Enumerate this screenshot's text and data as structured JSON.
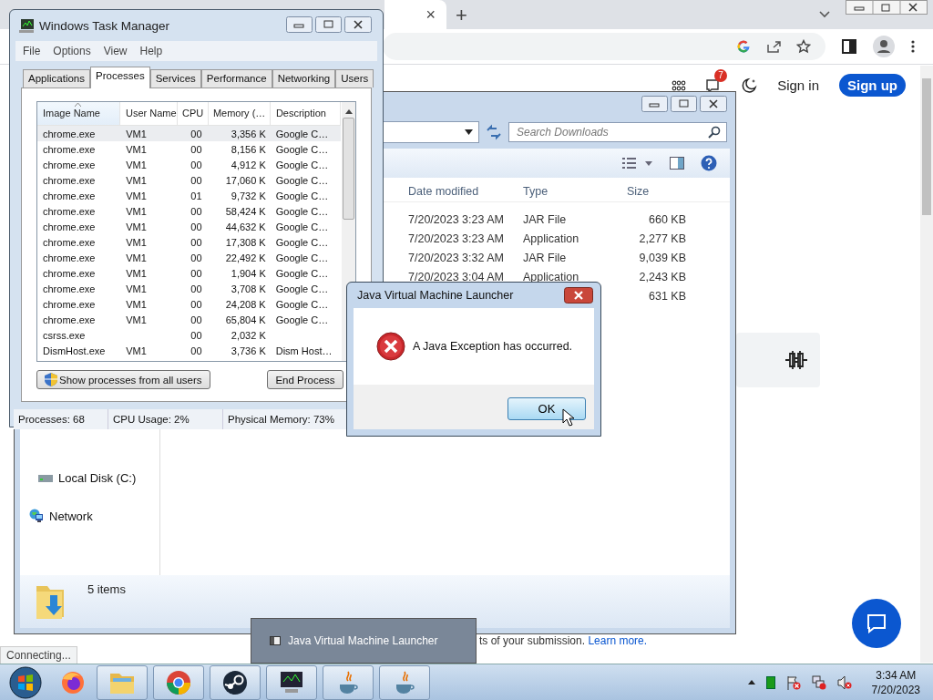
{
  "browser": {
    "tab_close": "×",
    "new_tab": "+",
    "sign_in": "Sign in",
    "sign_up": "Sign up",
    "notification_count": "7",
    "footer_text": "ts of your submission.",
    "footer_link": "Learn more.",
    "status": "Connecting..."
  },
  "explorer": {
    "search_placeholder": "Search Downloads",
    "columns": [
      "Date modified",
      "Type",
      "Size"
    ],
    "rows": [
      {
        "date": "7/20/2023 3:23 AM",
        "type": "JAR File",
        "size": "660 KB"
      },
      {
        "date": "7/20/2023 3:23 AM",
        "type": "Application",
        "size": "2,277 KB"
      },
      {
        "date": "7/20/2023 3:32 AM",
        "type": "JAR File",
        "size": "9,039 KB"
      },
      {
        "date": "7/20/2023 3:04 AM",
        "type": "Application",
        "size": "2,243 KB"
      },
      {
        "size": "631 KB"
      }
    ],
    "nav": [
      {
        "label": "Local Disk (C:)",
        "kind": "drive"
      },
      {
        "label": "Network",
        "kind": "network"
      }
    ],
    "status": "5 items"
  },
  "task_manager": {
    "title": "Windows Task Manager",
    "menu": [
      "File",
      "Options",
      "View",
      "Help"
    ],
    "tabs": [
      {
        "label": "Applications",
        "selected": false
      },
      {
        "label": "Processes",
        "selected": true
      },
      {
        "label": "Services",
        "selected": false
      },
      {
        "label": "Performance",
        "selected": false
      },
      {
        "label": "Networking",
        "selected": false
      },
      {
        "label": "Users",
        "selected": false
      }
    ],
    "columns": [
      {
        "label": "Image Name",
        "sorted": true
      },
      {
        "label": "User Name",
        "sorted": false
      },
      {
        "label": "CPU",
        "sorted": false
      },
      {
        "label": "Memory (…",
        "sorted": false
      },
      {
        "label": "Description",
        "sorted": false
      }
    ],
    "rows": [
      {
        "image": "chrome.exe",
        "user": "VM1",
        "cpu": "00",
        "memory": "3,356 K",
        "description": "Google C…",
        "selected": true
      },
      {
        "image": "chrome.exe",
        "user": "VM1",
        "cpu": "00",
        "memory": "8,156 K",
        "description": "Google C…",
        "selected": false
      },
      {
        "image": "chrome.exe",
        "user": "VM1",
        "cpu": "00",
        "memory": "4,912 K",
        "description": "Google C…",
        "selected": false
      },
      {
        "image": "chrome.exe",
        "user": "VM1",
        "cpu": "00",
        "memory": "17,060 K",
        "description": "Google C…",
        "selected": false
      },
      {
        "image": "chrome.exe",
        "user": "VM1",
        "cpu": "01",
        "memory": "9,732 K",
        "description": "Google C…",
        "selected": false
      },
      {
        "image": "chrome.exe",
        "user": "VM1",
        "cpu": "00",
        "memory": "58,424 K",
        "description": "Google C…",
        "selected": false
      },
      {
        "image": "chrome.exe",
        "user": "VM1",
        "cpu": "00",
        "memory": "44,632 K",
        "description": "Google C…",
        "selected": false
      },
      {
        "image": "chrome.exe",
        "user": "VM1",
        "cpu": "00",
        "memory": "17,308 K",
        "description": "Google C…",
        "selected": false
      },
      {
        "image": "chrome.exe",
        "user": "VM1",
        "cpu": "00",
        "memory": "22,492 K",
        "description": "Google C…",
        "selected": false
      },
      {
        "image": "chrome.exe",
        "user": "VM1",
        "cpu": "00",
        "memory": "1,904 K",
        "description": "Google C…",
        "selected": false
      },
      {
        "image": "chrome.exe",
        "user": "VM1",
        "cpu": "00",
        "memory": "3,708 K",
        "description": "Google C…",
        "selected": false
      },
      {
        "image": "chrome.exe",
        "user": "VM1",
        "cpu": "00",
        "memory": "24,208 K",
        "description": "Google C…",
        "selected": false
      },
      {
        "image": "chrome.exe",
        "user": "VM1",
        "cpu": "00",
        "memory": "65,804 K",
        "description": "Google C…",
        "selected": false
      },
      {
        "image": "csrss.exe",
        "cpu": "00",
        "memory": "2,032 K",
        "selected": false
      },
      {
        "image": "DismHost.exe",
        "user": "VM1",
        "cpu": "00",
        "memory": "3,736 K",
        "description": "Dism Host…",
        "selected": false
      }
    ],
    "show_all_button": "Show processes from all users",
    "end_button": "End Process",
    "status": [
      "Processes: 68",
      "CPU Usage: 2%",
      "Physical Memory: 73%"
    ]
  },
  "dialog": {
    "title": "Java Virtual Machine Launcher",
    "message": "A Java Exception has occurred.",
    "button": "OK"
  },
  "taskbar_tooltip": "Java Virtual Machine Launcher",
  "taskbar": {
    "time": "3:34 AM",
    "date": "7/20/2023"
  }
}
